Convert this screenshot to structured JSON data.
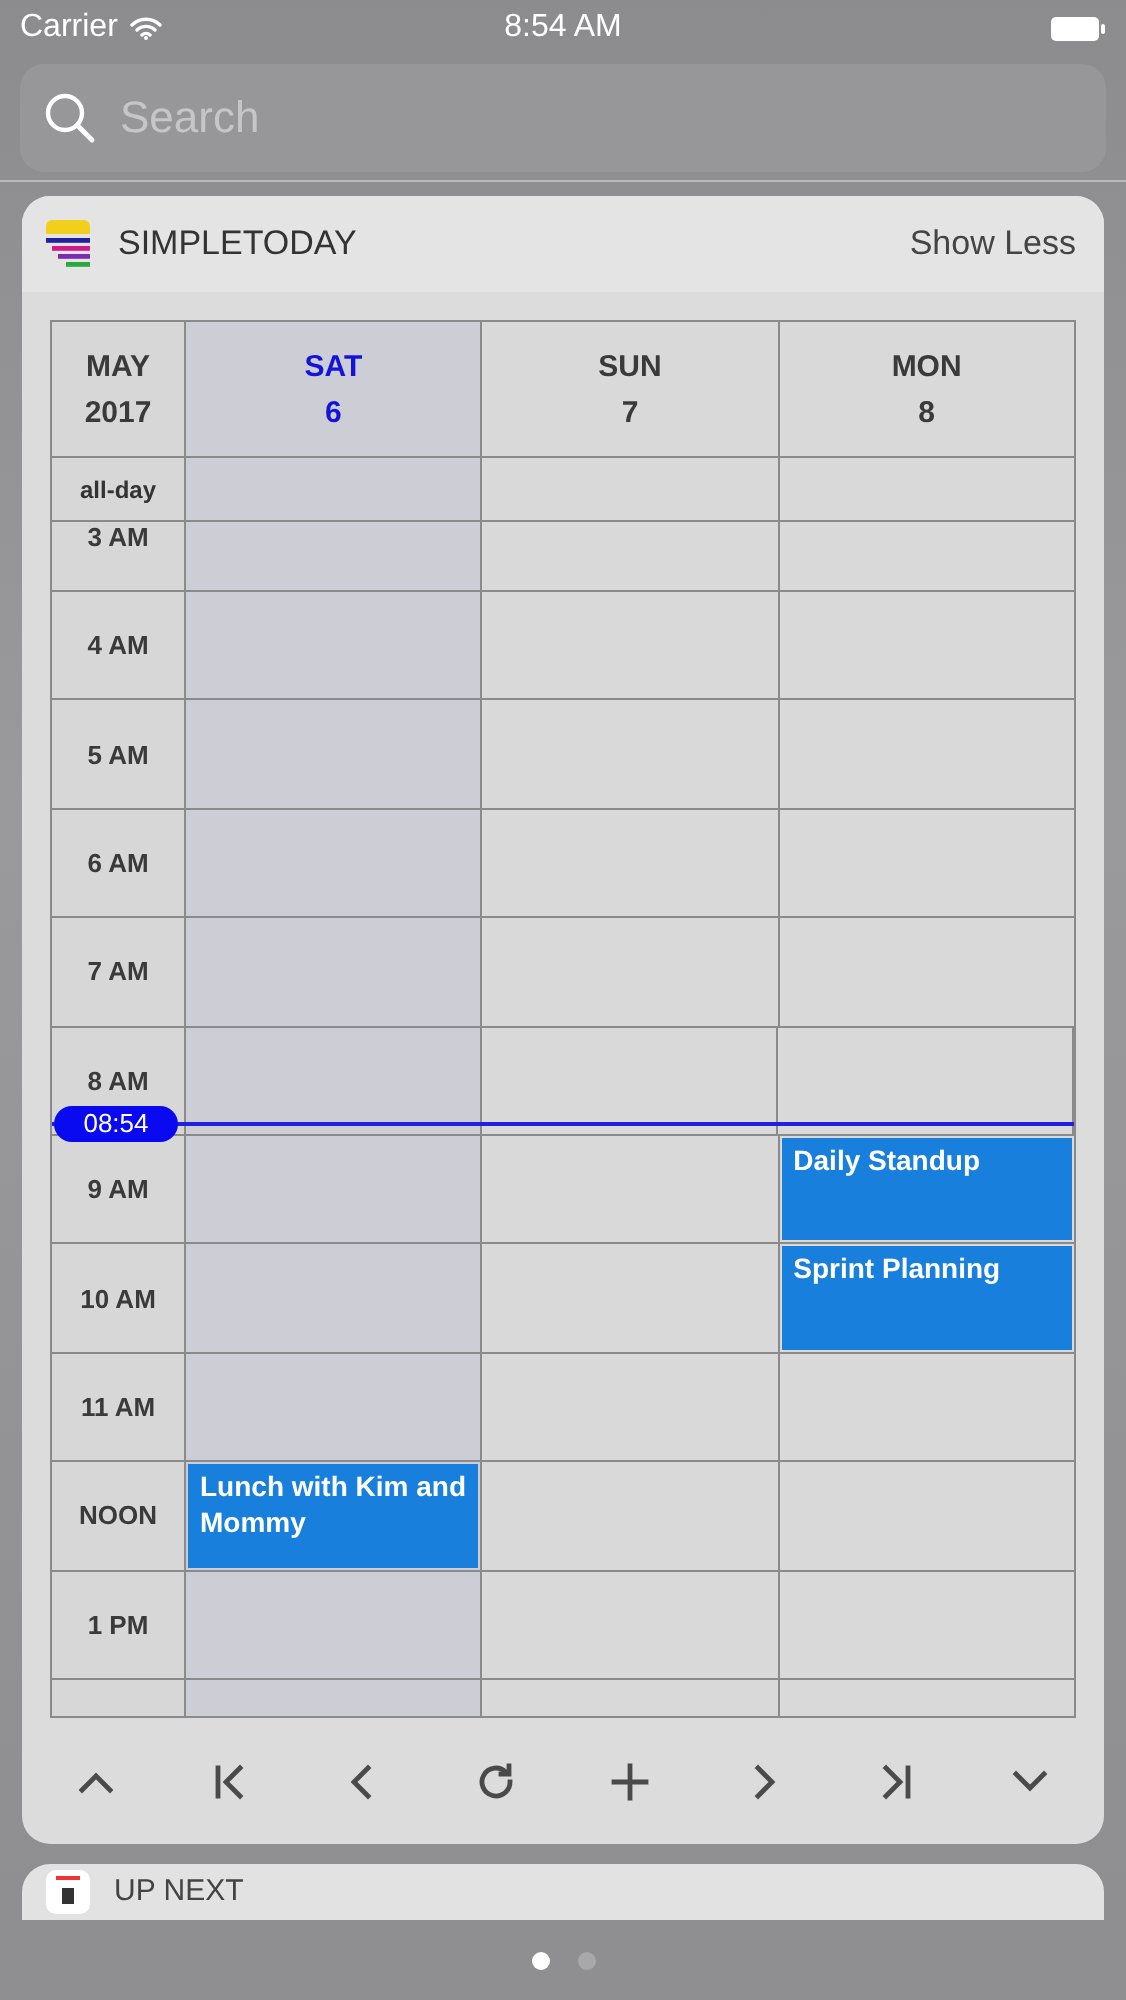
{
  "status_bar": {
    "carrier": "Carrier",
    "time": "8:54 AM"
  },
  "search": {
    "placeholder": "Search"
  },
  "widget": {
    "title": "SIMPLETODAY",
    "action": "Show Less",
    "calendar": {
      "month": "MAY",
      "year": "2017",
      "all_day_label": "all-day",
      "days": [
        {
          "weekday": "SAT",
          "date": "6",
          "today": true
        },
        {
          "weekday": "SUN",
          "date": "7",
          "today": false
        },
        {
          "weekday": "MON",
          "date": "8",
          "today": false
        }
      ],
      "hours": [
        {
          "label": "3 AM",
          "kind": "partial-top"
        },
        {
          "label": "4 AM",
          "kind": "hour"
        },
        {
          "label": "5 AM",
          "kind": "hour"
        },
        {
          "label": "6 AM",
          "kind": "hour"
        },
        {
          "label": "7 AM",
          "kind": "hour"
        },
        {
          "label": "8 AM",
          "kind": "hour",
          "now_marker": "08:54"
        },
        {
          "label": "9 AM",
          "kind": "hour",
          "cells": [
            {
              "kind": "free"
            },
            {
              "kind": "free"
            },
            {
              "kind": "event",
              "title": "Daily Standup"
            }
          ]
        },
        {
          "label": "10 AM",
          "kind": "hour",
          "cells": [
            {
              "kind": "free"
            },
            {
              "kind": "free"
            },
            {
              "kind": "event",
              "title": "Sprint Planning"
            }
          ]
        },
        {
          "label": "11 AM",
          "kind": "hour"
        },
        {
          "label": "NOON",
          "kind": "hour",
          "cells": [
            {
              "kind": "event",
              "title": "Lunch with Kim and Mommy"
            },
            {
              "kind": "free"
            },
            {
              "kind": "free"
            }
          ]
        },
        {
          "label": "1 PM",
          "kind": "hour"
        },
        {
          "kind": "partial-bottom"
        }
      ]
    },
    "toolbar": [
      {
        "kind": "up"
      },
      {
        "kind": "first"
      },
      {
        "kind": "prev"
      },
      {
        "kind": "refresh"
      },
      {
        "kind": "add"
      },
      {
        "kind": "next"
      },
      {
        "kind": "last"
      },
      {
        "kind": "down"
      }
    ]
  },
  "next_widget": {
    "title": "UP NEXT"
  },
  "page_dots": [
    {
      "selected": true
    },
    {
      "selected": false
    }
  ]
}
